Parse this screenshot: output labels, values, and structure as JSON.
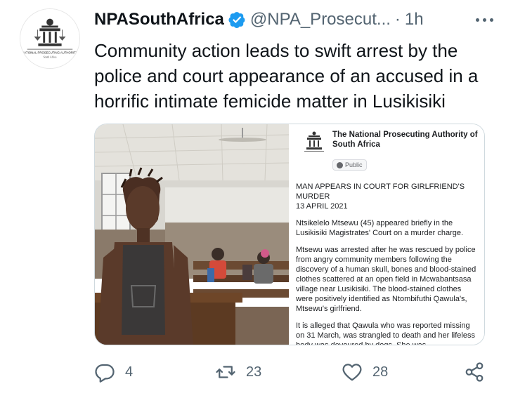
{
  "tweet": {
    "display_name": "NPASouthAfrica",
    "handle": "@NPA_Prosecut...",
    "separator": "·",
    "time": "1h",
    "text": "Community action leads to swift arrest by the police and court appearance of an accused in a horrific intimate femicide matter in Lusikisiki",
    "avatar_text": "NATIONAL PROSECUTING AUTHORITY",
    "avatar_subtext": "South Africa"
  },
  "document": {
    "org": "The National Prosecuting Authority of South Africa",
    "audience": "Public",
    "headline": "MAN APPEARS IN COURT FOR GIRLFRIEND'S MURDER",
    "date": "13 APRIL 2021",
    "para1": "Ntsikelelo Mtsewu (45) appeared briefly in the Lusikisiki Magistrates' Court on a murder charge.",
    "para2": "Mtsewu was arrested after he was rescued by police from angry community members following the discovery of a human skull, bones and blood-stained clothes scattered at an open field in Mcwabantsasa village near Lusikisiki. The blood-stained clothes were positively identified as Ntombifuthi Qawula's, Mtsewu's girlfriend.",
    "para3": "It is alleged that Qawula who was reported missing on 31 March, was strangled to death and her lifeless body was devoured by dogs. She was"
  },
  "actions": {
    "replies": "4",
    "retweets": "23",
    "likes": "28"
  },
  "icons": {
    "verified": "verified-badge-icon",
    "more": "more-options-icon",
    "reply": "reply-icon",
    "retweet": "retweet-icon",
    "like": "heart-icon",
    "share": "share-icon"
  },
  "colors": {
    "verified": "#1d9bf0",
    "secondary_text": "#536471",
    "primary_text": "#0f1419"
  }
}
